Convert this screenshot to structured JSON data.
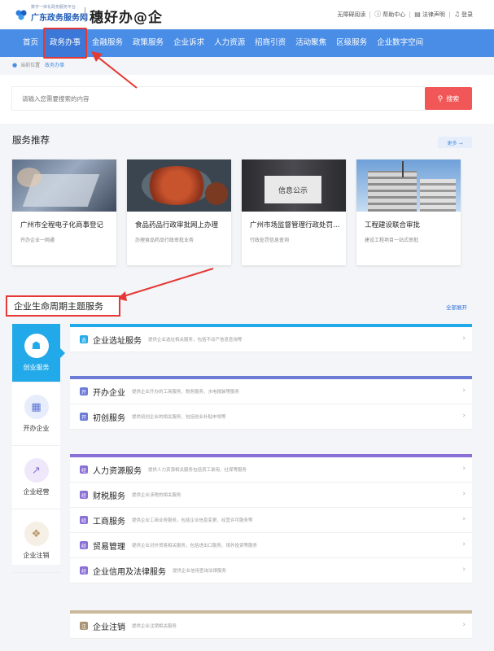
{
  "header": {
    "logo_small": "数字一体化政务服务平台",
    "logo_text": "广东政务服务网",
    "brand": "穗好办@企",
    "links": [
      "无障碍阅读",
      "帮助中心",
      "法律声明",
      "登录"
    ]
  },
  "nav": {
    "items": [
      "首页",
      "政务办事",
      "金融服务",
      "政策服务",
      "企业诉求",
      "人力资源",
      "招商引资",
      "活动聚焦",
      "区级服务",
      "企业数字空间"
    ],
    "active_index": 1
  },
  "breadcrumb": {
    "label": "当前位置",
    "current": "政务办事"
  },
  "search": {
    "placeholder": "请输入您需要搜索的内容",
    "button": "搜索"
  },
  "recommend": {
    "title": "服务推荐",
    "more": "更多 →",
    "cards": [
      {
        "title": "广州市全程电子化商事登记",
        "sub": "开办企业一网通"
      },
      {
        "title": "食品药品行政审批网上办理",
        "sub": "办理食品药品行政审批业务"
      },
      {
        "title": "广州市场监督管理行政处罚信息公示",
        "sub": "行政处罚信息查询",
        "img_text": "信息公示"
      },
      {
        "title": "工程建设联合审批",
        "sub": "建设工程项目一站式审批"
      }
    ]
  },
  "lifecycle": {
    "title": "企业生命周期主题服务",
    "expand": "全部展开",
    "stages": [
      "创业服务",
      "开办企业",
      "企业经营",
      "企业注销"
    ],
    "groups": [
      {
        "color": "#22a9e9",
        "items": [
          {
            "name": "企业选址服务",
            "desc": "提供企业选址相关服务，包括不动产信息查询等",
            "badge": "选"
          }
        ]
      },
      {
        "color": "#6c7bd6",
        "items": [
          {
            "name": "开办企业",
            "desc": "提供企业开办的工商服务、税务服务、水电报装等服务",
            "badge": "开"
          },
          {
            "name": "初创服务",
            "desc": "提供初创企业的相关服务，包括创业补贴申领等",
            "badge": "开"
          }
        ]
      },
      {
        "color": "#8a6fd6",
        "items": [
          {
            "name": "人力资源服务",
            "desc": "提供人力资源相关服务包括员工录用、社保等服务",
            "badge": "经"
          },
          {
            "name": "财税服务",
            "desc": "提供企业涉税的相关服务",
            "badge": "经"
          },
          {
            "name": "工商服务",
            "desc": "提供企业工商业务服务，包括企业信息变更、经营许可服务等",
            "badge": "经"
          },
          {
            "name": "贸易管理",
            "desc": "提供企业对外贸易相关服务，包括进出口服务、境外投资等服务",
            "badge": "经"
          },
          {
            "name": "企业信用及法律服务",
            "desc": "提供企业信用查询法律服务",
            "badge": "经"
          }
        ]
      },
      {
        "color": "#c9b99a",
        "items": [
          {
            "name": "企业注销",
            "desc": "提供企业注销相关服务",
            "badge": "注"
          }
        ]
      }
    ]
  },
  "colors": {
    "nav": "#4a8de6",
    "accent": "#22a9e9",
    "search_button": "#f25757",
    "annotation": "#e53935"
  }
}
